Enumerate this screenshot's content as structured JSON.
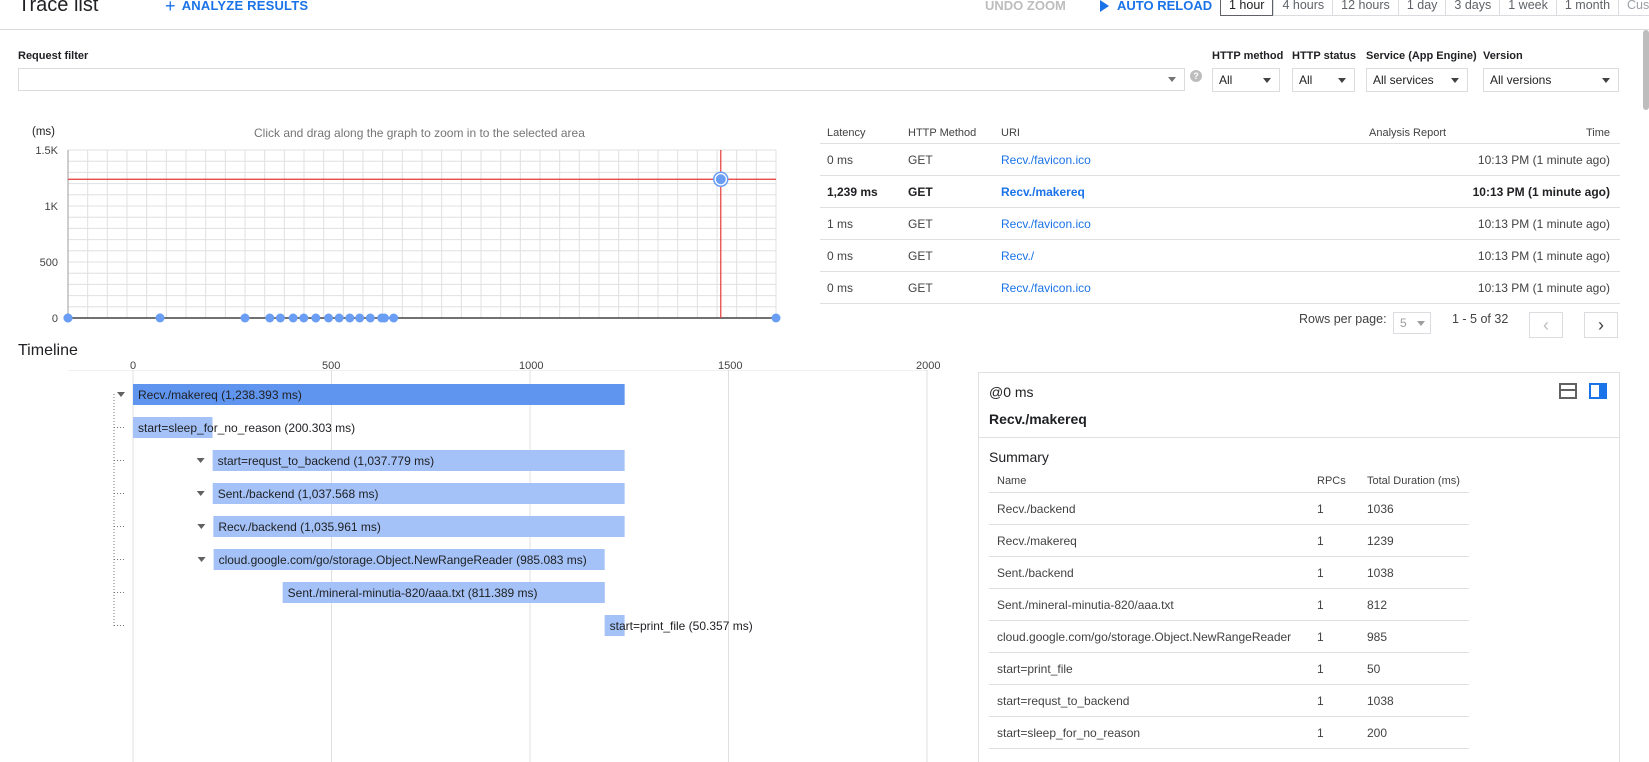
{
  "header": {
    "title": "Trace list",
    "analyze_label": "ANALYZE RESULTS",
    "undo_zoom_label": "UNDO ZOOM",
    "auto_reload_label": "AUTO RELOAD",
    "time_ranges": [
      "1 hour",
      "4 hours",
      "12 hours",
      "1 day",
      "3 days",
      "1 week",
      "1 month",
      "Custom"
    ],
    "active_range": "1 hour"
  },
  "filters": {
    "request_filter_label": "Request filter",
    "request_filter_value": "",
    "http_method_label": "HTTP method",
    "http_method_value": "All",
    "http_status_label": "HTTP status",
    "http_status_value": "All",
    "service_label": "Service (App Engine)",
    "service_value": "All services",
    "version_label": "Version",
    "version_value": "All versions"
  },
  "chart_hint": "Click and drag along the graph to zoom in to the selected area",
  "chart_data": {
    "type": "scatter",
    "ylabel": "(ms)",
    "y_ticks": [
      "0",
      "500",
      "1K",
      "1.5K"
    ],
    "ylim": [
      0,
      1500
    ],
    "x": [
      0,
      1,
      2,
      3,
      4,
      5,
      6,
      7,
      8,
      9,
      10,
      11,
      12,
      13,
      14,
      15,
      16,
      17,
      18
    ],
    "values": [
      0,
      1,
      0,
      0,
      0,
      0,
      0,
      0,
      0,
      0,
      0,
      0,
      0,
      0,
      0,
      0,
      1239,
      0,
      0
    ],
    "selected_value": 1239,
    "grid": true,
    "colors": {
      "point": "#6a9ef5",
      "crosshair": "#e53935"
    }
  },
  "trace_table": {
    "columns": {
      "latency": "Latency",
      "method": "HTTP Method",
      "uri": "URI",
      "analysis": "Analysis Report",
      "time": "Time"
    },
    "rows": [
      {
        "latency": "0 ms",
        "method": "GET",
        "uri": "Recv./favicon.ico",
        "time": "10:13 PM  (1 minute ago)"
      },
      {
        "latency": "1,239 ms",
        "method": "GET",
        "uri": "Recv./makereq",
        "time": "10:13 PM  (1 minute ago)"
      },
      {
        "latency": "1 ms",
        "method": "GET",
        "uri": "Recv./favicon.ico",
        "time": "10:13 PM  (1 minute ago)"
      },
      {
        "latency": "0 ms",
        "method": "GET",
        "uri": "Recv./",
        "time": "10:13 PM  (1 minute ago)"
      },
      {
        "latency": "0 ms",
        "method": "GET",
        "uri": "Recv./favicon.ico",
        "time": "10:13 PM  (1 minute ago)"
      }
    ],
    "rows_per_page_label": "Rows per page:",
    "rows_per_page": "5",
    "page_info": "1 - 5 of 32"
  },
  "timeline": {
    "title": "Timeline",
    "axis_ticks": [
      "0",
      "500",
      "1000",
      "1500",
      "2000"
    ],
    "axis_max": 2000,
    "spans": [
      {
        "label": "Recv./makereq (1,238.393 ms)",
        "start": 0,
        "duration": 1238.393,
        "expandable": true,
        "dark": true
      },
      {
        "label": "start=sleep_for_no_reason (200.303 ms)",
        "start": 0,
        "duration": 200.303,
        "expandable": false
      },
      {
        "label": "start=requst_to_backend (1,037.779 ms)",
        "start": 200.6,
        "duration": 1037.779,
        "expandable": true
      },
      {
        "label": "Sent./backend (1,037.568 ms)",
        "start": 200.8,
        "duration": 1037.568,
        "expandable": true
      },
      {
        "label": "Recv./backend (1,035.961 ms)",
        "start": 202.4,
        "duration": 1035.961,
        "expandable": true
      },
      {
        "label": "cloud.google.com/go/storage.Object.NewRangeReader (985.083 ms)",
        "start": 203,
        "duration": 985.083,
        "expandable": true
      },
      {
        "label": "Sent./mineral-minutia-820/aaa.txt (811.389 ms)",
        "start": 377,
        "duration": 811.389,
        "expandable": false
      },
      {
        "label": "start=print_file (50.357 ms)",
        "start": 1188,
        "duration": 50.357,
        "expandable": false
      }
    ]
  },
  "detail": {
    "offset": "@0 ms",
    "name": "Recv./makereq",
    "summary_label": "Summary",
    "columns": {
      "name": "Name",
      "rpcs": "RPCs",
      "duration": "Total Duration (ms)"
    },
    "rows": [
      {
        "name": "Recv./backend",
        "rpcs": "1",
        "duration": "1036"
      },
      {
        "name": "Recv./makereq",
        "rpcs": "1",
        "duration": "1239"
      },
      {
        "name": "Sent./backend",
        "rpcs": "1",
        "duration": "1038"
      },
      {
        "name": "Sent./mineral-minutia-820/aaa.txt",
        "rpcs": "1",
        "duration": "812"
      },
      {
        "name": "cloud.google.com/go/storage.Object.NewRangeReader",
        "rpcs": "1",
        "duration": "985"
      },
      {
        "name": "start=print_file",
        "rpcs": "1",
        "duration": "50"
      },
      {
        "name": "start=requst_to_backend",
        "rpcs": "1",
        "duration": "1038"
      },
      {
        "name": "start=sleep_for_no_reason",
        "rpcs": "1",
        "duration": "200"
      }
    ]
  }
}
